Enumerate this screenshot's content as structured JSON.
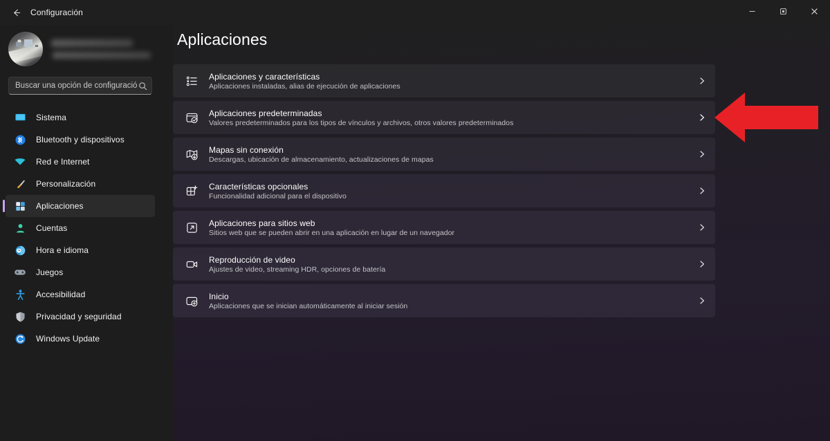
{
  "window": {
    "title": "Configuración",
    "back_icon": "back-arrow-icon",
    "controls": {
      "minimize": "minimize-icon",
      "restore": "restore-icon",
      "close": "close-icon"
    }
  },
  "accounts": {
    "name_redacted": "",
    "email_redacted": "",
    "avatar_icon": "user-avatar-photo"
  },
  "search": {
    "value": "",
    "placeholder": "Buscar una opción de configuración",
    "icon": "search-icon"
  },
  "sidebar": {
    "selected": "Aplicaciones",
    "accent_color": "#c9a3ef",
    "items": [
      {
        "label": "Sistema",
        "icon": "monitor-icon",
        "color": "#31b0e8",
        "selected": false
      },
      {
        "label": "Bluetooth y dispositivos",
        "icon": "bluetooth-icon",
        "color": "#1f7fe5",
        "selected": false
      },
      {
        "label": "Red e Internet",
        "icon": "wifi-icon",
        "color": "#2bc0d8",
        "selected": false
      },
      {
        "label": "Personalización",
        "icon": "paintbrush-icon",
        "color": "#e8a33d",
        "selected": false
      },
      {
        "label": "Aplicaciones",
        "icon": "apps-grid-icon",
        "color": "#4fa8e8",
        "selected": true
      },
      {
        "label": "Cuentas",
        "icon": "person-icon",
        "color": "#3fd0a8",
        "selected": false
      },
      {
        "label": "Hora e idioma",
        "icon": "clock-globe-icon",
        "color": "#2b9ae0",
        "selected": false
      },
      {
        "label": "Juegos",
        "icon": "gamepad-icon",
        "color": "#9aa3ad",
        "selected": false
      },
      {
        "label": "Accesibilidad",
        "icon": "accessibility-icon",
        "color": "#2e9be0",
        "selected": false
      },
      {
        "label": "Privacidad y seguridad",
        "icon": "shield-icon",
        "color": "#c8ccd2",
        "selected": false
      },
      {
        "label": "Windows Update",
        "icon": "update-icon",
        "color": "#2b8ae0",
        "selected": false
      }
    ]
  },
  "main": {
    "title": "Aplicaciones",
    "cards": [
      {
        "title": "Aplicaciones y características",
        "subtitle": "Aplicaciones instaladas, alias de ejecución de aplicaciones",
        "icon": "bulleted-list-icon",
        "chevron": "chevron-right-icon"
      },
      {
        "title": "Aplicaciones predeterminadas",
        "subtitle": "Valores predeterminados para los tipos de vínculos y archivos, otros valores predeterminados",
        "icon": "default-app-check-icon",
        "chevron": "chevron-right-icon"
      },
      {
        "title": "Mapas sin conexión",
        "subtitle": "Descargas, ubicación de almacenamiento, actualizaciones de mapas",
        "icon": "map-download-icon",
        "chevron": "chevron-right-icon"
      },
      {
        "title": "Características opcionales",
        "subtitle": "Funcionalidad adicional para el dispositivo",
        "icon": "grid-plus-icon",
        "chevron": "chevron-right-icon"
      },
      {
        "title": "Aplicaciones para sitios web",
        "subtitle": "Sitios web que se pueden abrir en una aplicación en lugar de un navegador",
        "icon": "external-link-square-icon",
        "chevron": "chevron-right-icon"
      },
      {
        "title": "Reproducción de video",
        "subtitle": "Ajustes de video, streaming HDR, opciones de batería",
        "icon": "video-camera-icon",
        "chevron": "chevron-right-icon"
      },
      {
        "title": "Inicio",
        "subtitle": "Aplicaciones que se inician automáticamente al iniciar sesión",
        "icon": "startup-apps-icon",
        "chevron": "chevron-right-icon"
      }
    ]
  },
  "annotation": {
    "arrow_icon": "left-pointing-arrow-annotation",
    "color": "#e82127",
    "points_at": "Aplicaciones predeterminadas"
  }
}
